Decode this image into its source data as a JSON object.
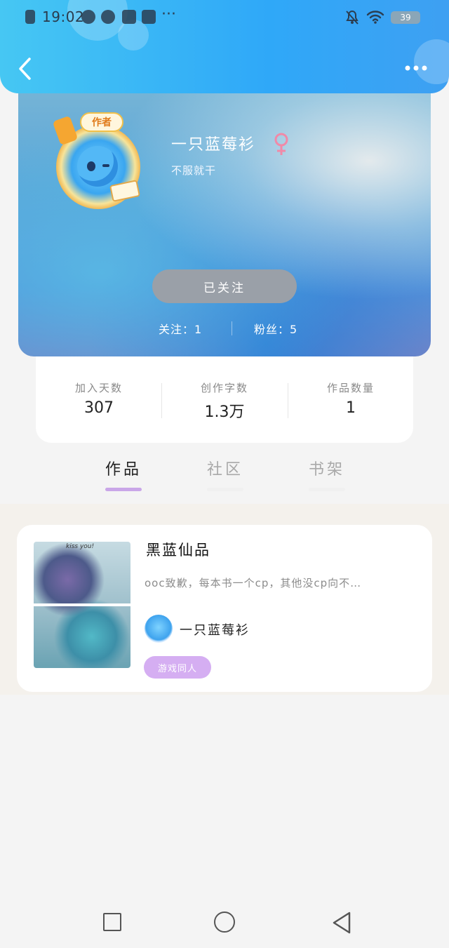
{
  "status_bar": {
    "time": "19:02",
    "more": "···",
    "battery": "39"
  },
  "profile": {
    "username": "一只蓝莓衫",
    "motto": "不服就干",
    "badge": "作者",
    "gender_icon": "female-symbol-icon",
    "follow_button": "已关注",
    "following": "关注：1",
    "fans": "粉丝：5"
  },
  "stats": [
    {
      "label": "加入天数",
      "value": "307"
    },
    {
      "label": "创作字数",
      "value": "1.3万"
    },
    {
      "label": "作品数量",
      "value": "1"
    }
  ],
  "tabs": [
    {
      "label": "作品",
      "active": true
    },
    {
      "label": "社区",
      "active": false
    },
    {
      "label": "书架",
      "active": false
    }
  ],
  "works": [
    {
      "title": "黑蓝仙品",
      "description": "ooc致歉，每本书一个cp，其他没cp向不…",
      "author": "一只蓝莓衫",
      "tag": "游戏同人",
      "cover_text": "kiss you!"
    }
  ],
  "colors": {
    "header_blue": "#2fa8f8",
    "tab_underline": "#c9a6e8",
    "tag_purple": "#d5aef2",
    "follow_button_gray": "#9aa0a8",
    "gender_pink": "#f08aa8"
  }
}
